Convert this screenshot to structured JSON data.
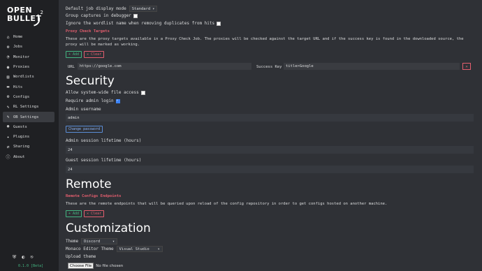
{
  "logo": {
    "line1": "OPEN",
    "line2": "BULLET",
    "version_mark": "2"
  },
  "sidebar": {
    "items": [
      {
        "label": "Home",
        "icon": "home-icon",
        "glyph": "⌂"
      },
      {
        "label": "Jobs",
        "icon": "jobs-icon",
        "glyph": "⚙"
      },
      {
        "label": "Monitor",
        "icon": "monitor-icon",
        "glyph": "◔"
      },
      {
        "label": "Proxies",
        "icon": "proxies-icon",
        "glyph": "◉"
      },
      {
        "label": "Wordlists",
        "icon": "wordlists-icon",
        "glyph": "▤"
      },
      {
        "label": "Hits",
        "icon": "hits-icon",
        "glyph": "▬"
      },
      {
        "label": "Configs",
        "icon": "configs-icon",
        "glyph": "⚙"
      },
      {
        "label": "RL Settings",
        "icon": "wrench-icon",
        "glyph": "✎"
      },
      {
        "label": "OB Settings",
        "icon": "wrench-icon",
        "glyph": "✎"
      },
      {
        "label": "Guests",
        "icon": "guests-icon",
        "glyph": "☻"
      },
      {
        "label": "Plugins",
        "icon": "plugins-icon",
        "glyph": "✦"
      },
      {
        "label": "Sharing",
        "icon": "sharing-icon",
        "glyph": "⇄"
      },
      {
        "label": "About",
        "icon": "info-icon",
        "glyph": "ⓘ"
      }
    ],
    "active_index": 8,
    "version": "0.1.0 [Beta]",
    "bottom_icons": [
      "⛨",
      "◐",
      "⎋"
    ]
  },
  "general": {
    "job_display_mode_label": "Default job display mode",
    "job_display_mode_value": "Standard",
    "group_captures_label": "Group captures in debugger",
    "ignore_wordlist_label": "Ignore the wordlist name when removing duplicates from hits"
  },
  "proxy_check": {
    "title": "Proxy Check Targets",
    "description": "These are the proxy targets available in a Proxy Check Job. The proxies will be checked against the target URL and if the success key is found in the downloaded source, the proxy will be marked as working.",
    "add_label": "Add",
    "clear_label": "Clear",
    "url_label": "URL",
    "url_value": "https://google.com",
    "success_key_label": "Success Key",
    "success_key_value": "title>Google",
    "remove_glyph": "✕"
  },
  "security": {
    "heading": "Security",
    "allow_file_access_label": "Allow system-wide file access",
    "require_login_label": "Require admin login",
    "require_login_checked": true,
    "admin_username_label": "Admin username",
    "admin_username_value": "admin",
    "change_password_label": "Change password",
    "admin_lifetime_label": "Admin session lifetime (hours)",
    "admin_lifetime_value": "24",
    "guest_lifetime_label": "Guest session lifetime (hours)",
    "guest_lifetime_value": "24"
  },
  "remote": {
    "heading": "Remote",
    "title": "Remote Configs Endpoints",
    "description": "These are the remote endpoints that will be queried upon reload of the config repository in order to get configs hosted on another machine.",
    "add_label": "Add",
    "clear_label": "Clear"
  },
  "customization": {
    "heading": "Customization",
    "theme_label": "Theme",
    "theme_value": "Discord",
    "editor_theme_label": "Monaco Editor Theme",
    "editor_theme_value": "Visual Studio",
    "upload_theme_label": "Upload theme",
    "choose_file_label": "Choose File",
    "no_file_label": "No file chosen"
  },
  "colors": {
    "accent_red": "#e35e6e",
    "accent_green": "#43b581",
    "bg": "#2f3136",
    "sidebar_bg": "#1f2023"
  }
}
